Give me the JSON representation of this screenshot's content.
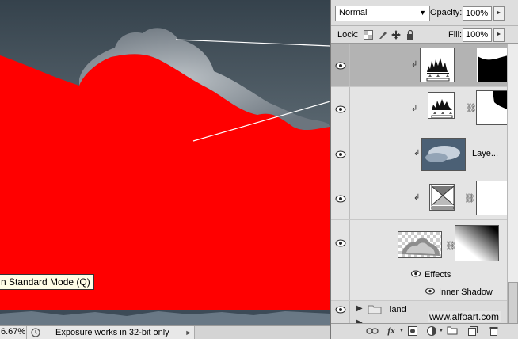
{
  "canvas": {
    "tooltip": "n Standard Mode (Q)",
    "accent_color": "#ff0000"
  },
  "status_bar": {
    "zoom": "6.67%",
    "message": "Exposure works in 32-bit only",
    "icon": "status-popup-icon",
    "arrow": "►"
  },
  "layers_panel": {
    "blend_mode": "Normal",
    "opacity_label": "Opacity:",
    "opacity_value": "100%",
    "lock_label": "Lock:",
    "fill_label": "Fill:",
    "fill_value": "100%",
    "rows": [
      {
        "kind": "adjustment-levels",
        "selected": true
      },
      {
        "kind": "adjustment-levels",
        "selected": false
      },
      {
        "kind": "image",
        "name": "Laye..."
      },
      {
        "kind": "adjustment-exposure",
        "selected": false
      },
      {
        "kind": "image-with-mask"
      }
    ],
    "effects_label": "Effects",
    "inner_shadow_label": "Inner Shadow",
    "group_name": "land",
    "watermark": "www.alfoart.com"
  }
}
